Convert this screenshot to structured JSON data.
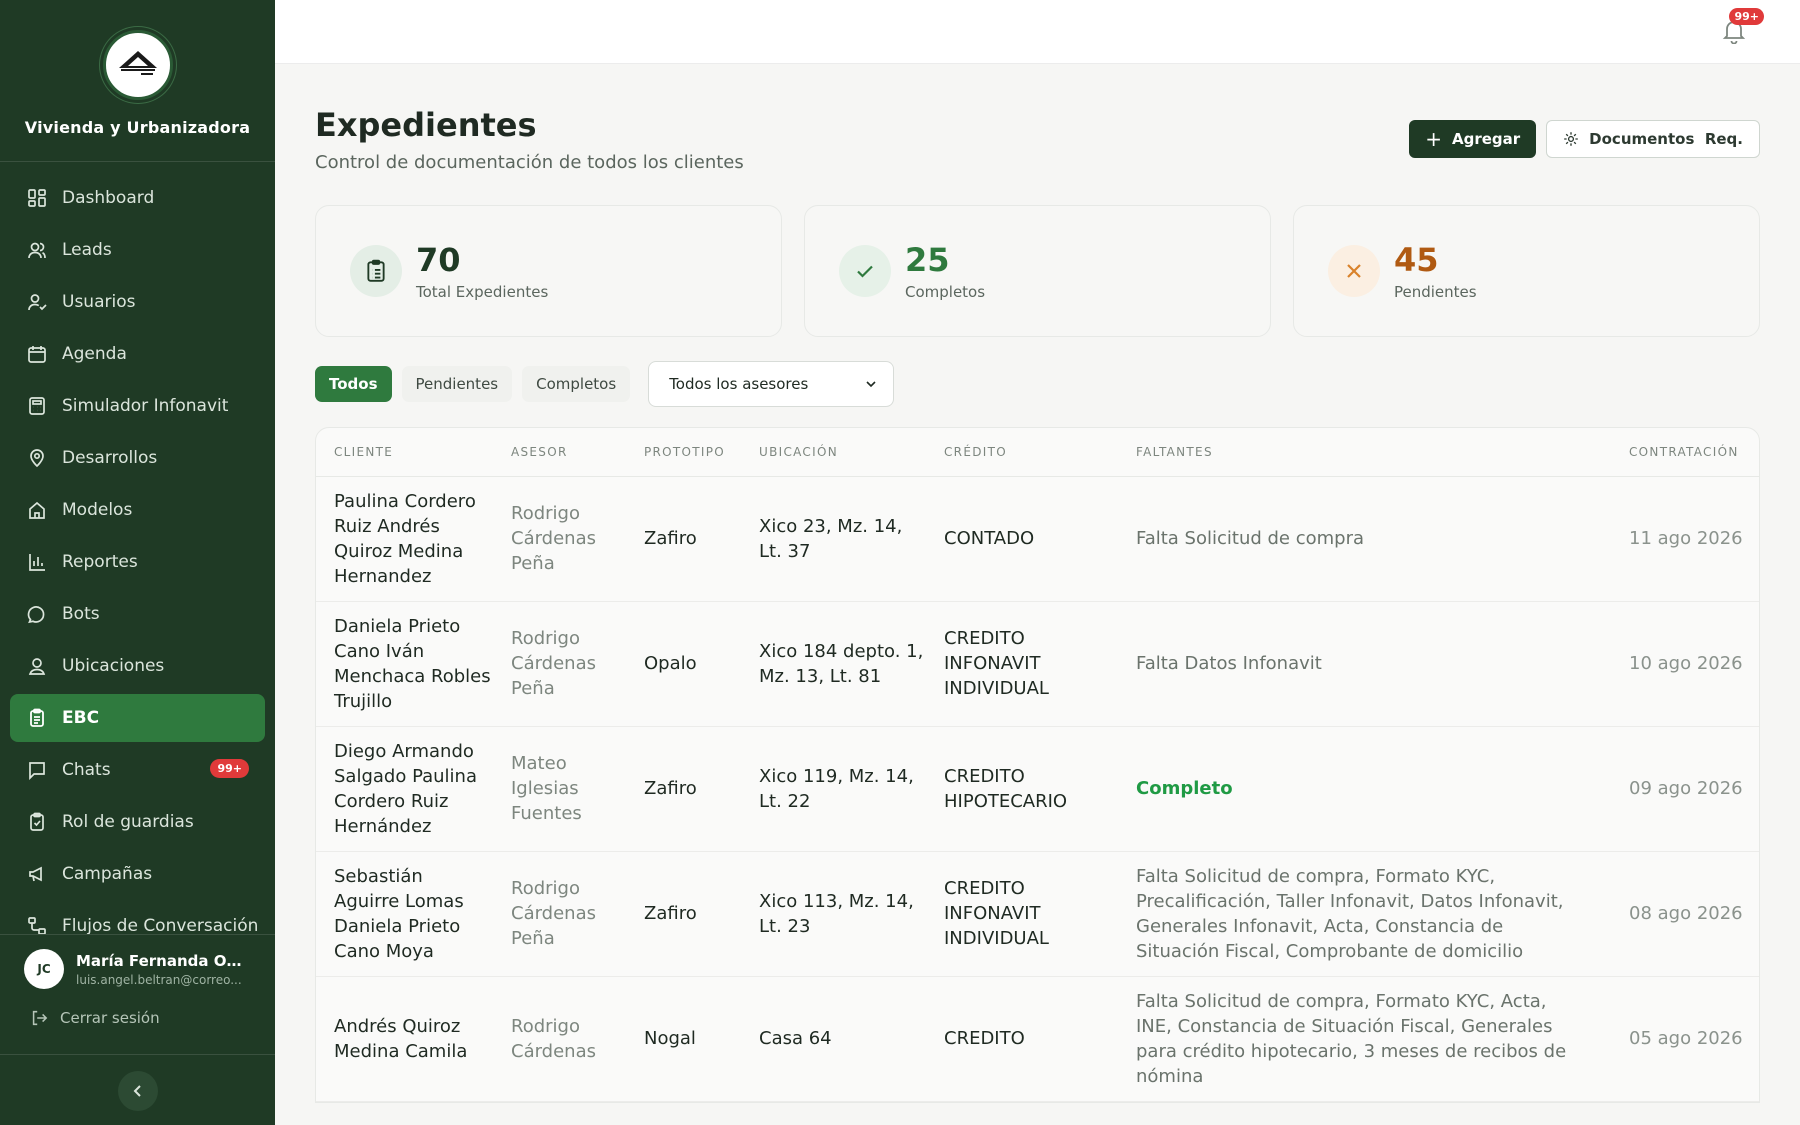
{
  "brand": {
    "name": "Vivienda y Urbanizadora"
  },
  "sidebar": {
    "items": [
      {
        "label": "Dashboard",
        "icon": "dashboard-icon"
      },
      {
        "label": "Leads",
        "icon": "users-icon"
      },
      {
        "label": "Usuarios",
        "icon": "user-check-icon"
      },
      {
        "label": "Agenda",
        "icon": "calendar-icon"
      },
      {
        "label": "Simulador Infonavit",
        "icon": "calculator-icon"
      },
      {
        "label": "Desarrollos",
        "icon": "map-pin-icon"
      },
      {
        "label": "Modelos",
        "icon": "house-icon"
      },
      {
        "label": "Reportes",
        "icon": "bar-chart-icon"
      },
      {
        "label": "Bots",
        "icon": "message-circle-icon"
      },
      {
        "label": "Ubicaciones",
        "icon": "user-location-icon"
      },
      {
        "label": "EBC",
        "icon": "clipboard-icon"
      },
      {
        "label": "Chats",
        "icon": "message-square-icon",
        "badge": "99+"
      },
      {
        "label": "Rol de guardias",
        "icon": "clipboard-check-icon"
      },
      {
        "label": "Campañas",
        "icon": "megaphone-icon"
      },
      {
        "label": "Flujos de Conversación",
        "icon": "workflow-icon"
      }
    ],
    "user": {
      "initials": "JC",
      "name": "María Fernanda Orte...",
      "email": "luis.angel.beltran@correo..."
    },
    "logout_label": "Cerrar sesión"
  },
  "topbar": {
    "notification_badge": "99+"
  },
  "page": {
    "title": "Expedientes",
    "subtitle": "Control de documentación de todos los clientes",
    "add_label": "Agregar",
    "docs_label": "Documentos  Req."
  },
  "stats": [
    {
      "value": "70",
      "label": "Total Expedientes",
      "color": "#1f3a25"
    },
    {
      "value": "25",
      "label": "Completos",
      "color": "#2f7a3e"
    },
    {
      "value": "45",
      "label": "Pendientes",
      "color": "#b05a12"
    }
  ],
  "filters": {
    "tabs": [
      "Todos",
      "Pendientes",
      "Completos"
    ],
    "asesor_select": "Todos los asesores"
  },
  "table": {
    "columns": [
      "CLIENTE",
      "ASESOR",
      "PROTOTIPO",
      "UBICACIÓN",
      "CRÉDITO",
      "FALTANTES",
      "CONTRATACIÓN"
    ],
    "rows": [
      {
        "cliente": "Paulina Cordero Ruiz Andrés Quiroz Medina Hernandez",
        "asesor": "Rodrigo Cárdenas Peña",
        "prototipo": "Zafiro",
        "ubicacion": "Xico 23, Mz. 14, Lt. 37",
        "credito": "CONTADO",
        "faltantes": "Falta Solicitud de compra",
        "contratacion": "11 ago 2026"
      },
      {
        "cliente": "Daniela Prieto Cano Iván Menchaca Robles Trujillo",
        "asesor": "Rodrigo Cárdenas Peña",
        "prototipo": "Opalo",
        "ubicacion": "Xico 184 depto. 1, Mz. 13, Lt. 81",
        "credito": "CREDITO INFONAVIT INDIVIDUAL",
        "faltantes": "Falta Datos Infonavit",
        "contratacion": "10 ago 2026"
      },
      {
        "cliente": "Diego Armando Salgado Paulina Cordero Ruiz Hernández",
        "asesor": "Mateo Iglesias Fuentes",
        "prototipo": "Zafiro",
        "ubicacion": "Xico 119, Mz. 14, Lt. 22",
        "credito": "CREDITO HIPOTECARIO",
        "faltantes": "Completo",
        "contratacion": "09 ago 2026"
      },
      {
        "cliente": "Sebastián Aguirre Lomas Daniela Prieto Cano Moya",
        "asesor": "Rodrigo Cárdenas Peña",
        "prototipo": "Zafiro",
        "ubicacion": "Xico 113, Mz. 14, Lt. 23",
        "credito": "CREDITO INFONAVIT INDIVIDUAL",
        "faltantes": "Falta Solicitud de compra, Formato KYC, Precalificación, Taller Infonavit, Datos Infonavit, Generales Infonavit, Acta, Constancia de Situación Fiscal, Comprobante de domicilio",
        "contratacion": "08 ago 2026"
      },
      {
        "cliente": "Andrés Quiroz Medina Camila",
        "asesor": "Rodrigo Cárdenas",
        "prototipo": "Nogal",
        "ubicacion": "Casa 64",
        "credito": "CREDITO",
        "faltantes": "Falta Solicitud de compra, Formato KYC, Acta, INE, Constancia de Situación Fiscal, Generales para crédito hipotecario, 3 meses de recibos de nómina",
        "contratacion": "05 ago 2026"
      }
    ]
  }
}
